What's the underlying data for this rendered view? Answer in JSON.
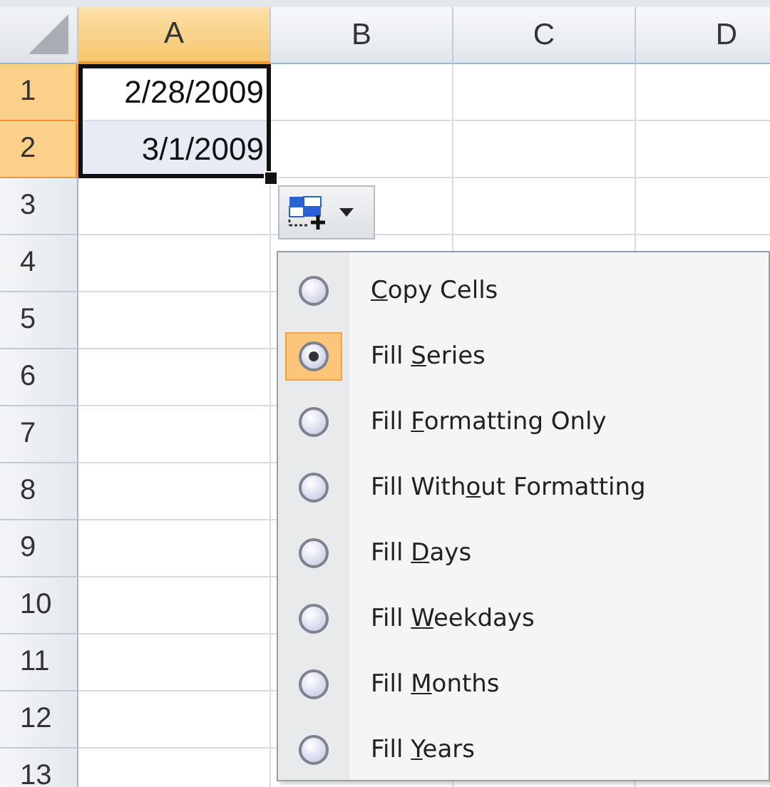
{
  "columns": [
    {
      "label": "A",
      "selected": true
    },
    {
      "label": "B",
      "selected": false
    },
    {
      "label": "C",
      "selected": false
    },
    {
      "label": "D",
      "selected": false
    }
  ],
  "rows": [
    {
      "label": "1",
      "selected": true,
      "cell": {
        "value": "2/28/2009",
        "highlighted": false
      }
    },
    {
      "label": "2",
      "selected": true,
      "cell": {
        "value": "3/1/2009",
        "highlighted": true
      }
    },
    {
      "label": "3",
      "selected": false
    },
    {
      "label": "4",
      "selected": false
    },
    {
      "label": "5",
      "selected": false
    },
    {
      "label": "6",
      "selected": false
    },
    {
      "label": "7",
      "selected": false
    },
    {
      "label": "8",
      "selected": false
    },
    {
      "label": "9",
      "selected": false
    },
    {
      "label": "10",
      "selected": false
    },
    {
      "label": "11",
      "selected": false
    },
    {
      "label": "12",
      "selected": false
    },
    {
      "label": "13",
      "selected": false
    }
  ],
  "autofill_menu": {
    "options": [
      {
        "mnemonic": "C",
        "after": "opy Cells",
        "selected": false
      },
      {
        "before": "Fill ",
        "mnemonic": "S",
        "after": "eries",
        "selected": true
      },
      {
        "before": "Fill ",
        "mnemonic": "F",
        "after": "ormatting Only",
        "selected": false
      },
      {
        "before": "Fill With",
        "mnemonic": "o",
        "after": "ut Formatting",
        "selected": false
      },
      {
        "before": "Fill ",
        "mnemonic": "D",
        "after": "ays",
        "selected": false
      },
      {
        "before": "Fill ",
        "mnemonic": "W",
        "after": "eekdays",
        "selected": false
      },
      {
        "before": "Fill ",
        "mnemonic": "M",
        "after": "onths",
        "selected": false
      },
      {
        "before": "Fill ",
        "mnemonic": "Y",
        "after": "ears",
        "selected": false
      }
    ]
  }
}
